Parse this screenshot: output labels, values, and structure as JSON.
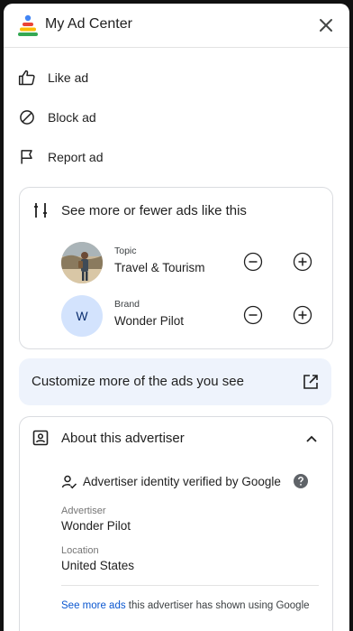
{
  "header": {
    "title": "My Ad Center",
    "close_icon": "close-icon"
  },
  "actions": [
    {
      "label": "Like ad",
      "icon": "thumb-up-icon"
    },
    {
      "label": "Block ad",
      "icon": "block-icon"
    },
    {
      "label": "Report ad",
      "icon": "flag-icon"
    }
  ],
  "preferences": {
    "heading": "See more or fewer ads like this",
    "icon": "tune-icon",
    "rows": [
      {
        "kind": "Topic",
        "value": "Travel & Tourism"
      },
      {
        "kind": "Brand",
        "value": "Wonder Pilot",
        "avatar_letter": "W"
      }
    ]
  },
  "customize": {
    "label": "Customize more of the ads you see",
    "icon": "open-in-new-icon"
  },
  "advertiser": {
    "heading": "About this advertiser",
    "verified": "Advertiser identity verified by Google",
    "fields": [
      {
        "label": "Advertiser",
        "value": "Wonder Pilot"
      },
      {
        "label": "Location",
        "value": "United States"
      }
    ],
    "footer_link": "See more ads",
    "footer_text": " this advertiser has shown using Google"
  },
  "colors": {
    "accent": "#0b57d0",
    "customize_bg": "#eef3fc",
    "avatar_bg": "#d3e3fd"
  }
}
